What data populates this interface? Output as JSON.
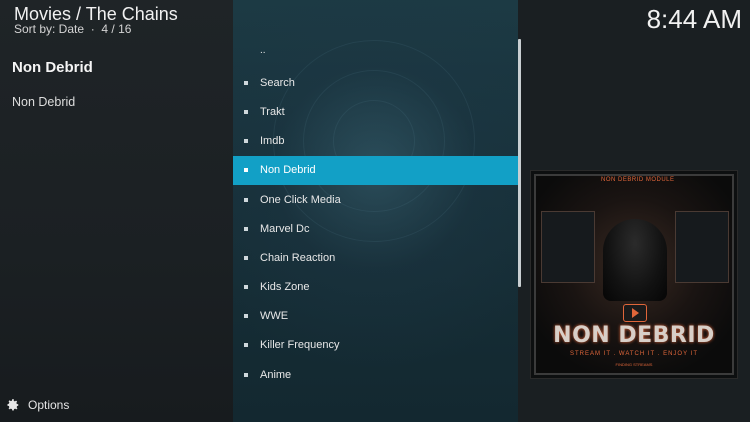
{
  "header": {
    "title": "Movies / The Chains",
    "sort_label": "Sort by: Date",
    "position": "4 / 16",
    "clock": "8:44 AM"
  },
  "info": {
    "title": "Non Debrid",
    "plot": "Non Debrid"
  },
  "list": {
    "items": [
      {
        "label": ".."
      },
      {
        "label": "Search"
      },
      {
        "label": "Trakt"
      },
      {
        "label": "Imdb"
      },
      {
        "label": "Non Debrid"
      },
      {
        "label": "One Click Media"
      },
      {
        "label": "Marvel Dc"
      },
      {
        "label": "Chain Reaction"
      },
      {
        "label": "Kids Zone"
      },
      {
        "label": "WWE"
      },
      {
        "label": "Killer Frequency"
      },
      {
        "label": "Anime"
      }
    ],
    "selected_index": 4
  },
  "poster": {
    "header_text": "NON DEBRID MODULE",
    "title_text": "NON DEBRID",
    "tagline": "STREAM IT . WATCH IT . ENJOY IT",
    "small_text": "FINDING STREAMS"
  },
  "footer": {
    "options_label": "Options",
    "options_icon": "gear-icon"
  },
  "colors": {
    "accent": "#12a0c6",
    "poster_accent": "#e0663a"
  }
}
